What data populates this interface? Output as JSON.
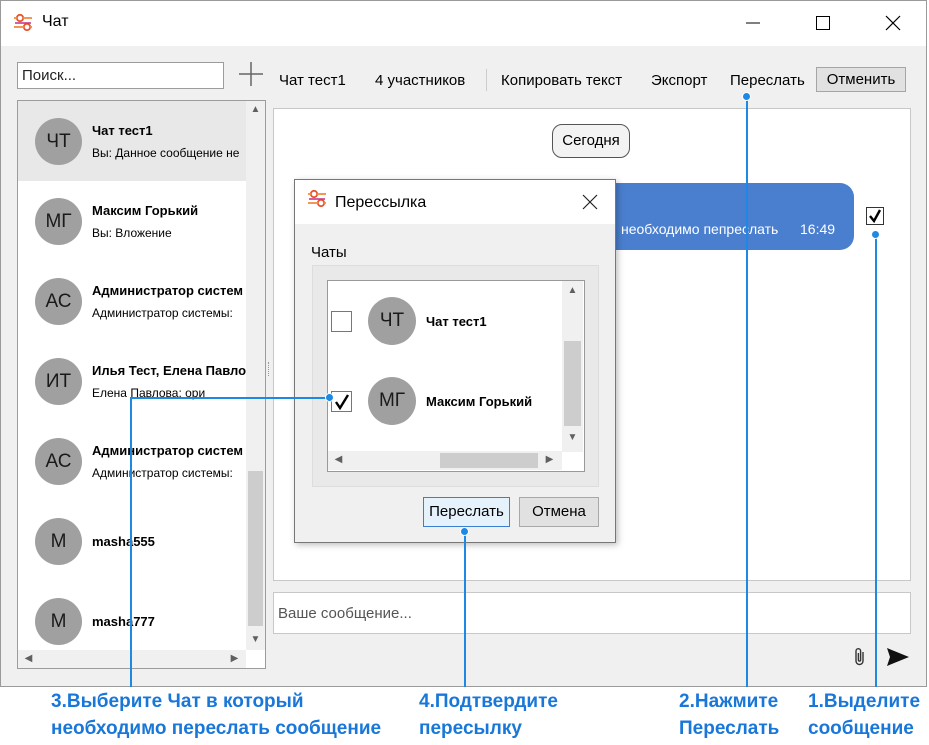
{
  "window": {
    "title": "Чат",
    "minimize_icon": "minimize-icon",
    "maximize_icon": "maximize-icon",
    "close_icon": "close-icon"
  },
  "search": {
    "placeholder": "Поиск..."
  },
  "toolbar": {
    "chat_name": "Чат тест1",
    "participants": "4 участников",
    "copy_text": "Копировать текст",
    "export": "Экспорт",
    "forward": "Переслать",
    "cancel": "Отменить"
  },
  "chats": [
    {
      "initials": "ЧТ",
      "name": "Чат тест1",
      "preview": "Вы: Данное сообщение не",
      "selected": true
    },
    {
      "initials": "МГ",
      "name": "Максим Горький",
      "preview": "Вы: Вложение"
    },
    {
      "initials": "АС",
      "name": "Администратор систем",
      "preview": "Администратор системы:"
    },
    {
      "initials": "ИТ",
      "name": "Илья Тест, Елена Павло",
      "preview": "Елена Павлова: ори"
    },
    {
      "initials": "АС",
      "name": "Администратор систем",
      "preview": "Администратор системы:"
    },
    {
      "initials": "М",
      "name": "masha555",
      "preview": ""
    },
    {
      "initials": "М",
      "name": "masha777",
      "preview": ""
    }
  ],
  "messages": {
    "date_separator": "Сегодня",
    "bubble_text": "необходимо пепреслать",
    "bubble_time": "16:49",
    "selected": true
  },
  "composer": {
    "placeholder": "Ваше сообщение..."
  },
  "dialog": {
    "title": "Пересcылка",
    "group_label": "Чаты",
    "items": [
      {
        "initials": "ЧТ",
        "name": "Чат тест1",
        "checked": false
      },
      {
        "initials": "МГ",
        "name": "Максим Горький",
        "checked": true
      }
    ],
    "forward_button": "Переслать",
    "cancel_button": "Отмена"
  },
  "annotations": {
    "step3_line1": "3.Выберите Чат в который",
    "step3_line2": "необходимо переслать сообщение",
    "step4_line1": "4.Подтвердите",
    "step4_line2": "пересылку",
    "step2_line1": "2.Нажмите",
    "step2_line2": "Переслать",
    "step1_line1": "1.Выделите",
    "step1_line2": "сообщение"
  },
  "colors": {
    "accent": "#1877d8",
    "bubble": "#4a7fcf",
    "avatar": "#a0a0a0"
  }
}
